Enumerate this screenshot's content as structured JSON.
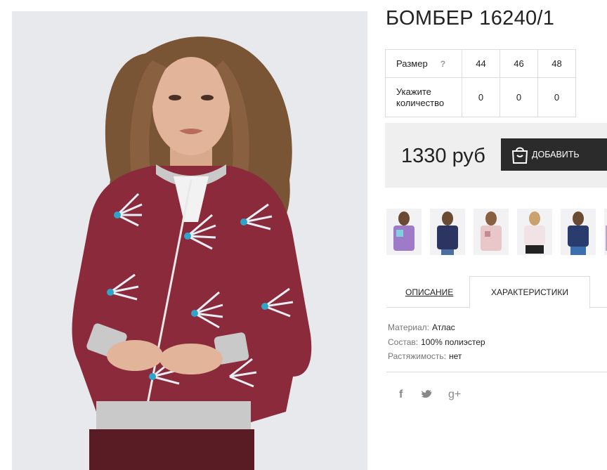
{
  "product": {
    "title": "БОМБЕР 16240/1",
    "price": "1330 руб",
    "add_button_label": "ДОБАВИТЬ"
  },
  "size_table": {
    "size_label": "Размер",
    "help_mark": "?",
    "sizes": [
      "44",
      "46",
      "48"
    ],
    "quantity_label": "Укажите количество",
    "quantities": [
      "0",
      "0",
      "0"
    ]
  },
  "tabs": {
    "description": "ОПИСАНИЕ",
    "characteristics": "ХАРАКТЕРИСТИКИ"
  },
  "specs": [
    {
      "key": "Материал:",
      "value": "Атлас"
    },
    {
      "key": "Состав:",
      "value": "100% полиэстер"
    },
    {
      "key": "Растяжимость:",
      "value": "нет"
    }
  ],
  "social": {
    "facebook": "f",
    "twitter": "twitter-bird",
    "googleplus": "g+"
  },
  "colors": {
    "button_bg": "#2b2b2b",
    "price_bar_bg": "#efefef",
    "jacket": "#8b2a3a",
    "border": "#dcdcdc"
  },
  "icons": [
    "shopping-bag-icon",
    "help-icon",
    "facebook-icon",
    "twitter-icon",
    "googleplus-icon"
  ]
}
